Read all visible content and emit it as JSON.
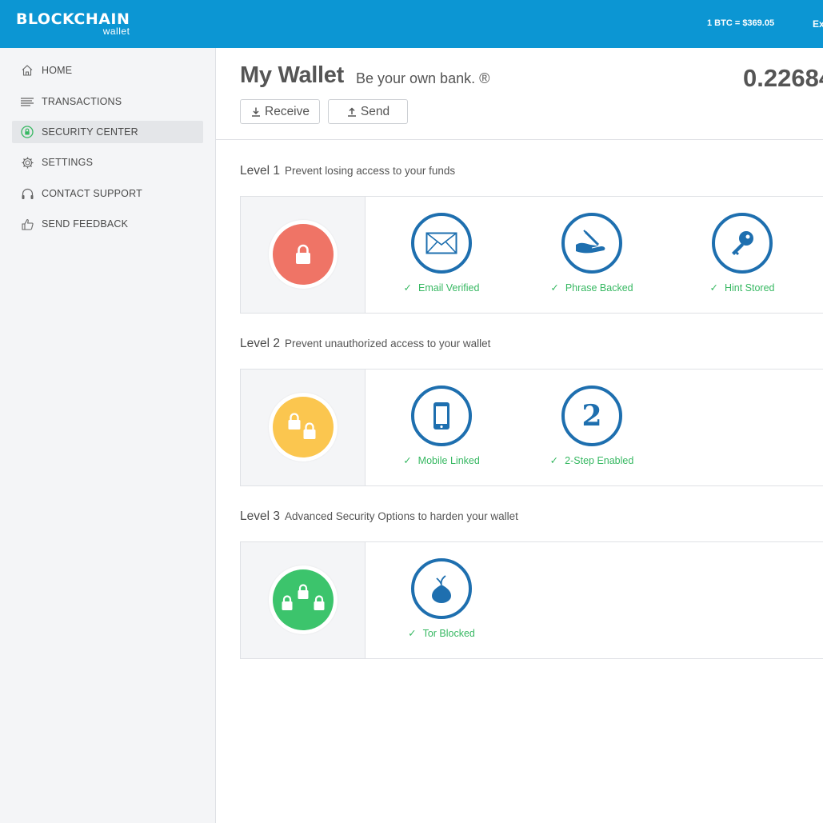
{
  "header": {
    "logo_main": "BLOCKCHAIN",
    "logo_sub": "wallet",
    "rate": "1 BTC = $369.05",
    "right_clipped": "Ex"
  },
  "sidebar": {
    "items": [
      {
        "label": "HOME",
        "icon": "home-icon"
      },
      {
        "label": "TRANSACTIONS",
        "icon": "transactions-icon"
      },
      {
        "label": "SECURITY CENTER",
        "icon": "lock-icon",
        "active": true
      },
      {
        "label": "SETTINGS",
        "icon": "gear-icon"
      },
      {
        "label": "CONTACT SUPPORT",
        "icon": "headset-icon"
      },
      {
        "label": "SEND FEEDBACK",
        "icon": "thumbs-up-icon"
      }
    ]
  },
  "main": {
    "title": "My Wallet",
    "tagline": "Be your own bank. ®",
    "balance": "0.22684",
    "buttons": {
      "receive": "Receive",
      "send": "Send"
    }
  },
  "levels": [
    {
      "level": "Level 1",
      "description": "Prevent losing access to your funds",
      "badge_color": "#ef7466",
      "features": [
        {
          "label": "Email Verified",
          "icon": "envelope-icon"
        },
        {
          "label": "Phrase Backed",
          "icon": "hand-writing-icon"
        },
        {
          "label": "Hint Stored",
          "icon": "key-icon"
        }
      ]
    },
    {
      "level": "Level 2",
      "description": "Prevent unauthorized access to your wallet",
      "badge_color": "#fbc64f",
      "features": [
        {
          "label": "Mobile Linked",
          "icon": "mobile-phone-icon"
        },
        {
          "label": "2-Step Enabled",
          "icon": "number-two-icon"
        }
      ]
    },
    {
      "level": "Level 3",
      "description": "Advanced Security Options to harden your wallet",
      "badge_color": "#3cc46c",
      "features": [
        {
          "label": "Tor Blocked",
          "icon": "onion-icon"
        }
      ]
    }
  ],
  "colors": {
    "topbar": "#0c96d3",
    "feature_ring": "#1e6faf",
    "check_green": "#37b862",
    "sidebar_bg": "#f4f5f7"
  }
}
